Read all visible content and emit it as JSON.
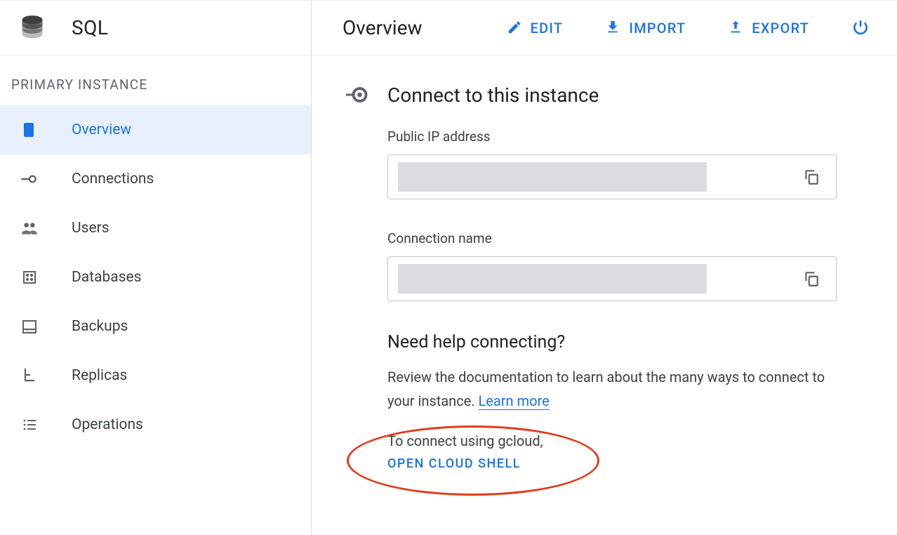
{
  "sidebar": {
    "product": "SQL",
    "section_label": "PRIMARY INSTANCE",
    "items": [
      {
        "label": "Overview",
        "icon": "overview",
        "active": true
      },
      {
        "label": "Connections",
        "icon": "connections",
        "active": false
      },
      {
        "label": "Users",
        "icon": "users",
        "active": false
      },
      {
        "label": "Databases",
        "icon": "databases",
        "active": false
      },
      {
        "label": "Backups",
        "icon": "backups",
        "active": false
      },
      {
        "label": "Replicas",
        "icon": "replicas",
        "active": false
      },
      {
        "label": "Operations",
        "icon": "operations",
        "active": false
      }
    ]
  },
  "toolbar": {
    "title": "Overview",
    "actions": [
      {
        "label": "EDIT",
        "icon": "edit"
      },
      {
        "label": "IMPORT",
        "icon": "import"
      },
      {
        "label": "EXPORT",
        "icon": "export"
      }
    ],
    "overflow_icon": "restart"
  },
  "connect_card": {
    "title": "Connect to this instance",
    "fields": [
      {
        "label": "Public IP address",
        "value": "",
        "redacted": true
      },
      {
        "label": "Connection name",
        "value": "",
        "redacted": true
      }
    ],
    "help": {
      "title": "Need help connecting?",
      "text_prefix": "Review the documentation to learn about the many ways to connect to your instance. ",
      "learn_more": "Learn more",
      "gcloud_text": "To connect using gcloud,",
      "open_shell": "OPEN CLOUD SHELL"
    }
  }
}
